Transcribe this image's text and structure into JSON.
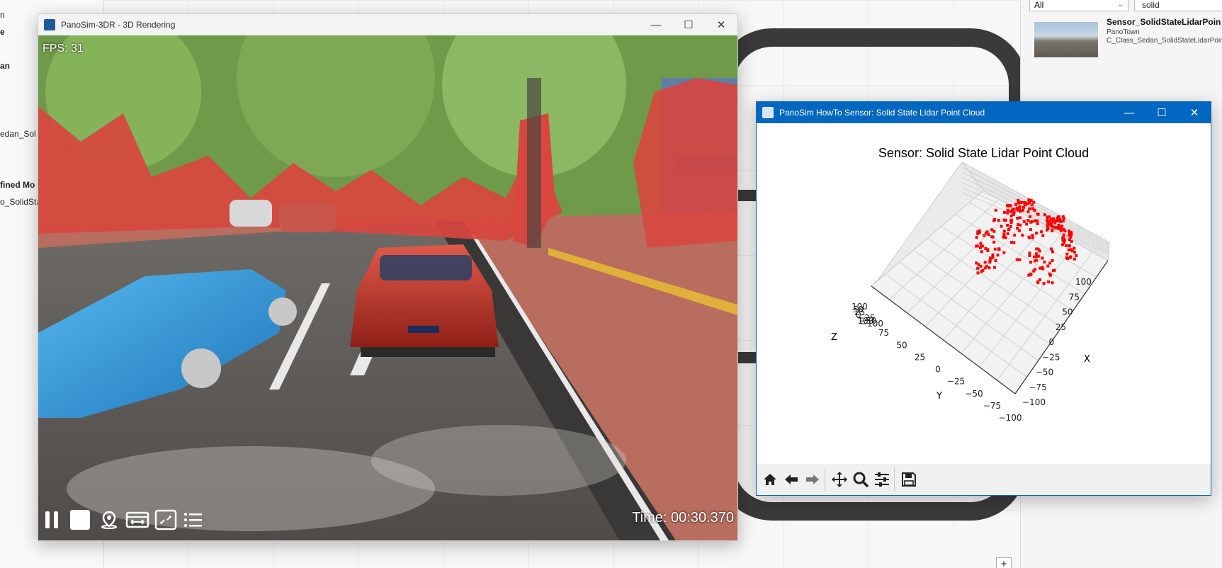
{
  "background_app": {
    "left_panel_texts": [
      "n",
      "e",
      "an",
      "edan_Sol",
      "fined Mo",
      "o_SolidSta"
    ],
    "filter_value": "All",
    "search_value": "solid",
    "result": {
      "title": "Sensor_SolidStateLidarPoin",
      "map": "PanoTown",
      "vehicle": "C_Class_Sedan_SolidStateLidarPointC"
    },
    "add_label": "+"
  },
  "render_window": {
    "title": "PanoSim-3DR - 3D Rendering",
    "fps": "FPS: 31",
    "time": "Time: 00:30.370",
    "controls": [
      "pause-icon",
      "stop-icon",
      "location-pin-icon",
      "view-width-icon",
      "fullscreen-icon",
      "list-icon"
    ]
  },
  "lidar_window": {
    "title": "PanoSim HowTo Sensor: Solid State Lidar Point Cloud",
    "point_color": "#ff0000",
    "toolbar": [
      "home-icon",
      "back-arrow-icon",
      "forward-arrow-icon",
      "pan-icon",
      "zoom-icon",
      "configure-icon",
      "save-icon"
    ]
  },
  "chart_data": {
    "type": "scatter",
    "projection": "3d",
    "title": "Sensor: Solid State Lidar Point Cloud",
    "xlabel": "X",
    "ylabel": "Y",
    "zlabel": "Z",
    "xlim": [
      -100,
      100
    ],
    "ylim": [
      -100,
      100
    ],
    "zlim": [
      -100,
      100
    ],
    "x_ticks": [
      "−100",
      "−75",
      "−50",
      "−25",
      "0",
      "25",
      "50",
      "75",
      "100"
    ],
    "y_ticks": [
      "100",
      "75",
      "50",
      "25",
      "0",
      "−25",
      "−50",
      "−75",
      "−100"
    ],
    "z_ticks": [
      "100",
      "50",
      "25",
      "0",
      "−25",
      "−50",
      "−100"
    ],
    "grid": true,
    "series_color": "#ff0000"
  }
}
